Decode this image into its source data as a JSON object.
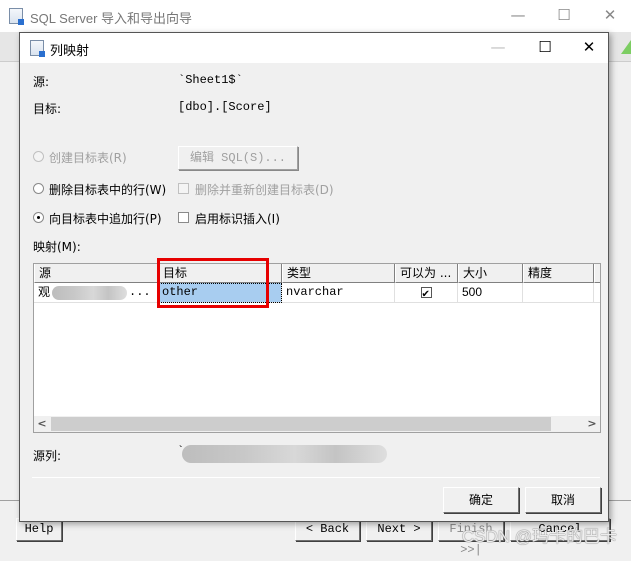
{
  "outer_window": {
    "title": "SQL Server 导入和导出向导",
    "controls": {
      "minimize": "—",
      "maximize": "☐",
      "close": "✕"
    },
    "footer_buttons": {
      "help": "Help",
      "back": "< Back",
      "next": "Next >",
      "finish": "Finish >>|",
      "cancel": "Cancel"
    }
  },
  "dialog": {
    "title": "列映射",
    "controls": {
      "minimize": "—",
      "maximize": "☐",
      "close": "✕"
    },
    "source_label": "源:",
    "source_value": "`Sheet1$`",
    "target_label": "目标:",
    "target_value": "[dbo].[Score]",
    "options": {
      "create_table": {
        "label": "创建目标表(R)",
        "enabled": false,
        "checked": false
      },
      "edit_sql": {
        "label": "编辑 SQL(S)...",
        "enabled": false
      },
      "delete_rows": {
        "label": "删除目标表中的行(W)",
        "enabled": true,
        "checked": false
      },
      "drop_recreate": {
        "label": "删除并重新创建目标表(D)",
        "enabled": false,
        "checked": false
      },
      "append_rows": {
        "label": "向目标表中追加行(P)",
        "enabled": true,
        "checked": true
      },
      "identity_insert": {
        "label": "启用标识插入(I)",
        "enabled": true,
        "checked": false
      }
    },
    "mapping_label": "映射(M):",
    "mapping_grid": {
      "columns": [
        "源",
        "目标",
        "类型",
        "可以为 ...",
        "大小",
        "精度",
        "."
      ],
      "rows": [
        {
          "source": "观",
          "source_suffix": "...",
          "target": "other",
          "type": "nvarchar",
          "nullable": true,
          "size": "500",
          "precision": ""
        }
      ]
    },
    "source_column_label": "源列:",
    "source_column_value": "`",
    "ok_label": "确定",
    "cancel_label": "取消"
  },
  "highlight": {
    "color": "#e60000",
    "target": "目标 column"
  },
  "watermark": "CSDN @玛卡的巴卡"
}
